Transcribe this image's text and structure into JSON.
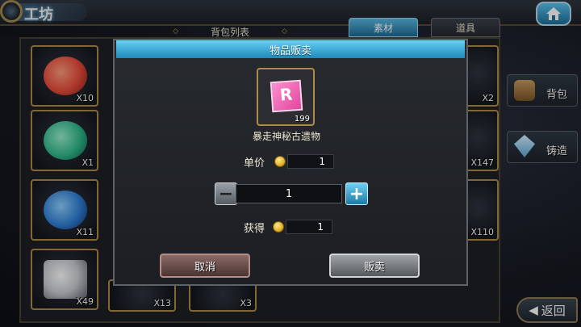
{
  "header": {
    "title": "工坊",
    "home_icon": "home-icon"
  },
  "tabs": {
    "list_title": "背包列表",
    "material_label": "素材",
    "items_label": "道具"
  },
  "inventory": {
    "left_column": [
      {
        "qty": "X10",
        "color": "#e84a3a"
      },
      {
        "qty": "X1",
        "color": "#2fb98a"
      },
      {
        "qty": "X11",
        "color": "#2f7fd6"
      },
      {
        "qty": "X49",
        "color": "#c9ccd2"
      }
    ],
    "right_column": [
      {
        "qty": "X2"
      },
      {
        "qty": "X147"
      },
      {
        "qty": "X110"
      }
    ],
    "bottom_row": [
      {
        "qty": "X13"
      },
      {
        "qty": "X3"
      }
    ]
  },
  "side_menu": {
    "bag_label": "背包",
    "forge_label": "铸造",
    "back_label": "返回"
  },
  "modal": {
    "title": "物品贩卖",
    "item_name": "暴走神秘古遗物",
    "item_count": "199",
    "item_letter": "R",
    "item_color": "#e0479e",
    "unit_price_label": "单价",
    "unit_price_value": "1",
    "quantity_value": "1",
    "gain_label": "获得",
    "gain_value": "1",
    "cancel_label": "取消",
    "sell_label": "贩卖"
  }
}
